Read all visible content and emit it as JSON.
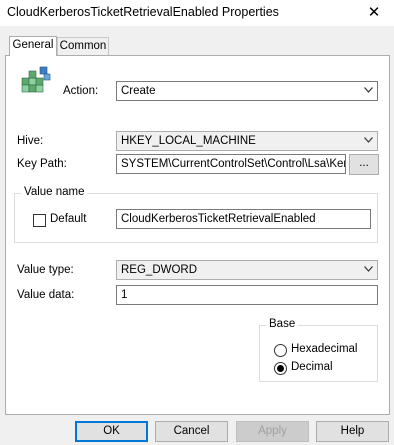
{
  "window": {
    "title": "CloudKerberosTicketRetrievalEnabled Properties",
    "close_glyph": "✕"
  },
  "tabs": [
    {
      "label": "General",
      "selected": true
    },
    {
      "label": "Common",
      "selected": false
    }
  ],
  "icon": "registry-cubes-icon",
  "action": {
    "label": "Action:",
    "value": "Create"
  },
  "hive": {
    "label": "Hive:",
    "value": "HKEY_LOCAL_MACHINE"
  },
  "key_path": {
    "label": "Key Path:",
    "value": "SYSTEM\\CurrentControlSet\\Control\\Lsa\\Kerbe",
    "browse_label": "..."
  },
  "value_name": {
    "group_title": "Value name",
    "default_label": "Default",
    "default_checked": false,
    "value": "CloudKerberosTicketRetrievalEnabled"
  },
  "value_type": {
    "label": "Value type:",
    "value": "REG_DWORD"
  },
  "value_data": {
    "label": "Value data:",
    "value": "1"
  },
  "base": {
    "group_title": "Base",
    "options": [
      {
        "label": "Hexadecimal",
        "selected": false
      },
      {
        "label": "Decimal",
        "selected": true
      }
    ]
  },
  "buttons": {
    "ok": "OK",
    "cancel": "Cancel",
    "apply": "Apply",
    "help": "Help"
  },
  "colors": {
    "accent": "#0078d7",
    "panel_bg": "#ffffff",
    "dialog_bg": "#f0f0f0"
  }
}
